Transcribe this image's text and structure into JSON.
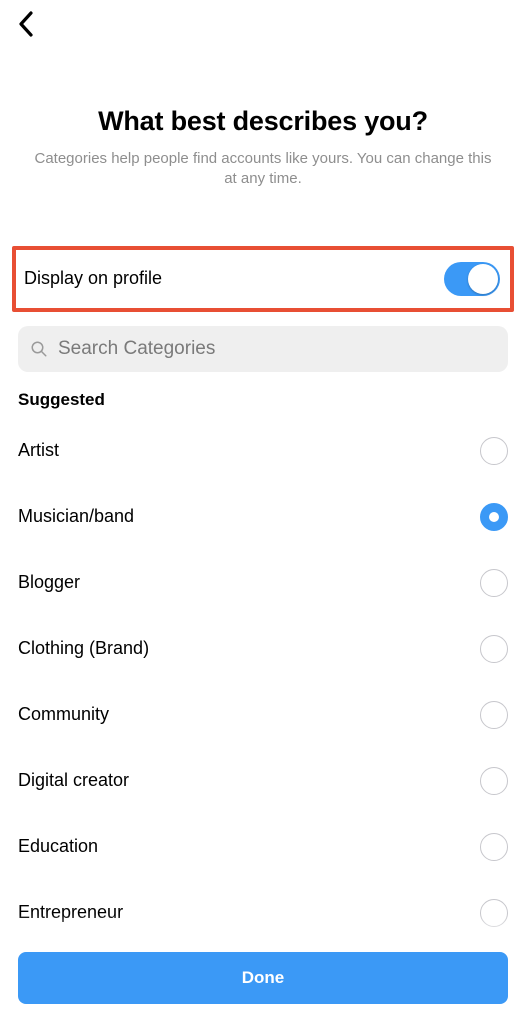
{
  "header": {
    "title": "What best describes you?",
    "subtitle": "Categories help people find accounts like yours. You can change this at any time."
  },
  "toggle_row": {
    "highlighted": true,
    "label": "Display on profile",
    "value": true
  },
  "search": {
    "placeholder": "Search Categories",
    "value": ""
  },
  "section_label": "Suggested",
  "categories": [
    {
      "label": "Artist",
      "selected": false
    },
    {
      "label": "Musician/band",
      "selected": true
    },
    {
      "label": "Blogger",
      "selected": false
    },
    {
      "label": "Clothing (Brand)",
      "selected": false
    },
    {
      "label": "Community",
      "selected": false
    },
    {
      "label": "Digital creator",
      "selected": false
    },
    {
      "label": "Education",
      "selected": false
    },
    {
      "label": "Entrepreneur",
      "selected": false
    }
  ],
  "footer": {
    "done_label": "Done"
  },
  "colors": {
    "accent": "#3B99F6",
    "highlight_border": "#E84F34"
  }
}
